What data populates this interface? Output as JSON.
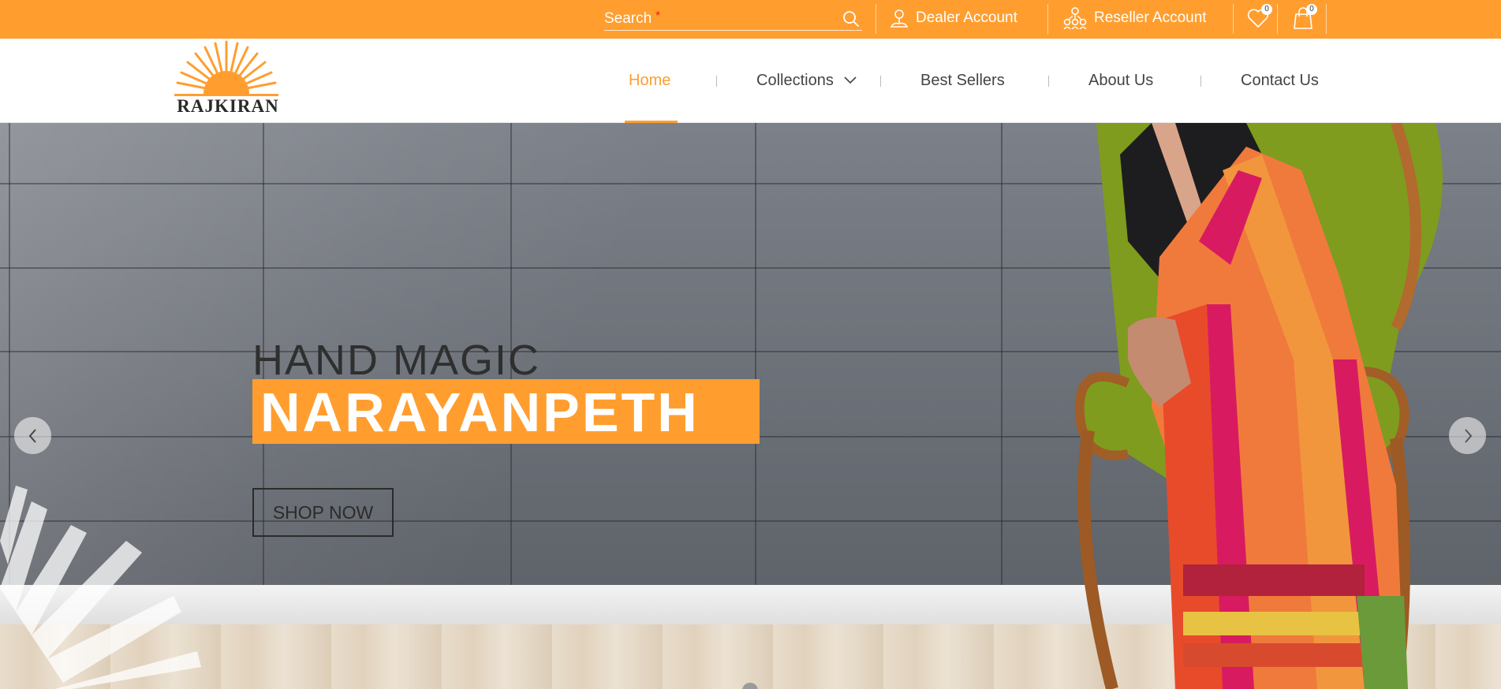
{
  "topbar": {
    "search_placeholder": "Search",
    "search_required_mark": "*",
    "dealer_label": "Dealer Account",
    "reseller_label": "Reseller Account",
    "wishlist_count": "0",
    "cart_count": "0"
  },
  "header": {
    "logo_text": "RAJKIRAN",
    "nav": {
      "home": "Home",
      "collections": "Collections",
      "best_sellers": "Best Sellers",
      "about": "About Us",
      "contact": "Contact Us"
    }
  },
  "hero": {
    "subtitle": "HAND MAGIC",
    "title": "NARAYANPETH",
    "cta": "SHOP NOW"
  },
  "colors": {
    "accent": "#ff9e2f",
    "text_dark": "#2f2f2f"
  },
  "icons": [
    "search-icon",
    "dealer-icon",
    "reseller-icon",
    "heart-icon",
    "cart-icon",
    "chevron-down-icon",
    "chevron-left-icon",
    "chevron-right-icon"
  ]
}
